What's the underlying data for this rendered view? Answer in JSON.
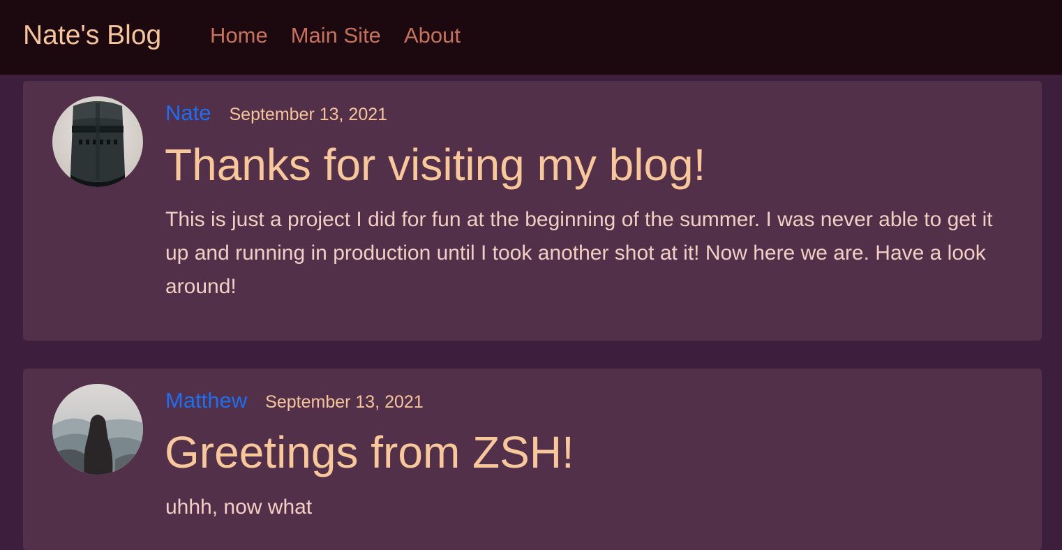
{
  "nav": {
    "brand": "Nate's Blog",
    "links": [
      "Home",
      "Main Site",
      "About"
    ]
  },
  "posts": [
    {
      "author": "Nate",
      "date": "September 13, 2021",
      "title": "Thanks for visiting my blog!",
      "body": "This is just a project I did for fun at the beginning of the summer. I was never able to get it up and running in production until I took another shot at it! Now here we are. Have a look around!"
    },
    {
      "author": "Matthew",
      "date": "September 13, 2021",
      "title": "Greetings from ZSH!",
      "body": "uhhh, now what"
    }
  ],
  "colors": {
    "page_bg": "#3d1f3d",
    "navbar_bg": "#1c0910",
    "card_bg": "#52304a",
    "brand": "#f6c59a",
    "nav_link": "#c8715a",
    "author_link": "#1e6ef0",
    "title": "#f9c89a",
    "body": "#f1cfc2"
  }
}
